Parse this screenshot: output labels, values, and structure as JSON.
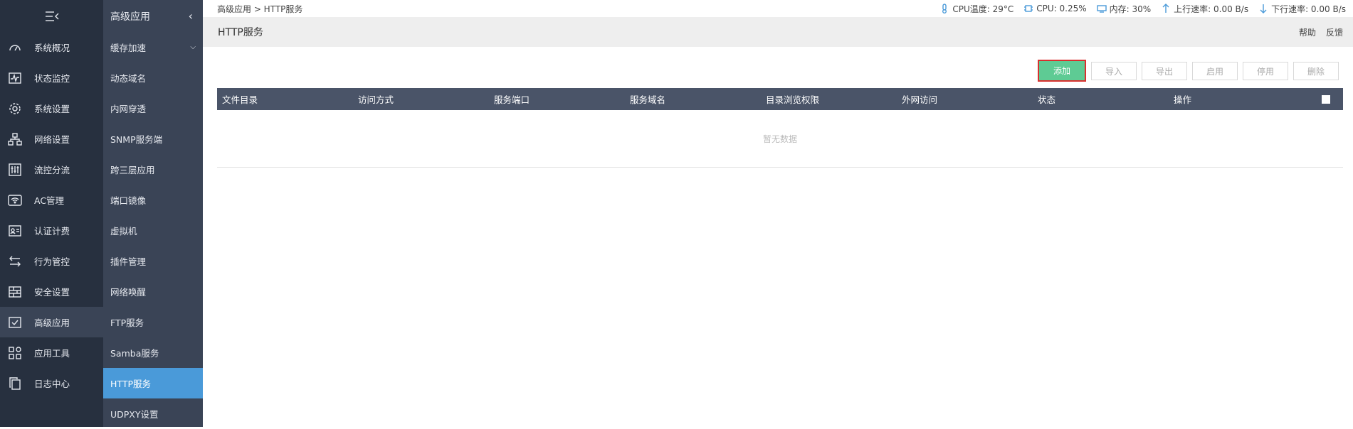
{
  "nav1": {
    "items": [
      {
        "label": "系统概况",
        "icon": "dashboard-icon"
      },
      {
        "label": "状态监控",
        "icon": "monitor-icon"
      },
      {
        "label": "系统设置",
        "icon": "gear-icon"
      },
      {
        "label": "网络设置",
        "icon": "network-icon"
      },
      {
        "label": "流控分流",
        "icon": "sliders-icon"
      },
      {
        "label": "AC管理",
        "icon": "wifi-icon"
      },
      {
        "label": "认证计费",
        "icon": "id-card-icon"
      },
      {
        "label": "行为管控",
        "icon": "swap-icon"
      },
      {
        "label": "安全设置",
        "icon": "firewall-icon"
      },
      {
        "label": "高级应用",
        "icon": "checkbox-icon"
      },
      {
        "label": "应用工具",
        "icon": "apps-icon"
      },
      {
        "label": "日志中心",
        "icon": "copy-icon"
      }
    ]
  },
  "nav2": {
    "title": "高级应用",
    "items": [
      "缓存加速",
      "动态域名",
      "内网穿透",
      "SNMP服务端",
      "跨三层应用",
      "端口镜像",
      "虚拟机",
      "插件管理",
      "网络唤醒",
      "FTP服务",
      "Samba服务",
      "HTTP服务",
      "UDPXY设置"
    ]
  },
  "breadcrumb": "高级应用 > HTTP服务",
  "stats": {
    "cpu_temp": "CPU温度: 29°C",
    "cpu": "CPU: 0.25%",
    "memory": "内存: 30%",
    "upload": "上行速率: 0.00 B/s",
    "download": "下行速率: 0.00 B/s"
  },
  "page": {
    "title": "HTTP服务",
    "help": "帮助",
    "feedback": "反馈"
  },
  "toolbar": {
    "add": "添加",
    "import": "导入",
    "export": "导出",
    "enable": "启用",
    "disable": "停用",
    "delete": "删除"
  },
  "table": {
    "columns": [
      "文件目录",
      "访问方式",
      "服务端口",
      "服务域名",
      "目录浏览权限",
      "外网访问",
      "状态",
      "操作"
    ],
    "empty": "暂无数据"
  },
  "colors": {
    "accent": "#4a9ad9",
    "primary_button": "#5ecb94",
    "header_bg": "#4a5468",
    "sidebar_bg": "#27303f"
  }
}
